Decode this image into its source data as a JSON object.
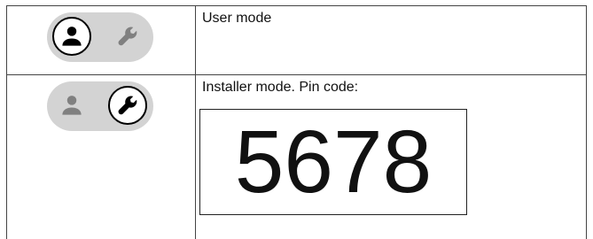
{
  "rows": [
    {
      "mode": "user",
      "active_icon": "user-icon",
      "inactive_icon": "wrench-icon",
      "label": "User mode"
    },
    {
      "mode": "installer",
      "active_icon": "wrench-icon",
      "inactive_icon": "user-icon",
      "label": "Installer mode. Pin code:",
      "pin_code": "5678"
    }
  ],
  "colors": {
    "pill_background": "#d3d3d3",
    "inactive_icon": "#808080",
    "active_icon": "#000000",
    "border": "#444444"
  }
}
